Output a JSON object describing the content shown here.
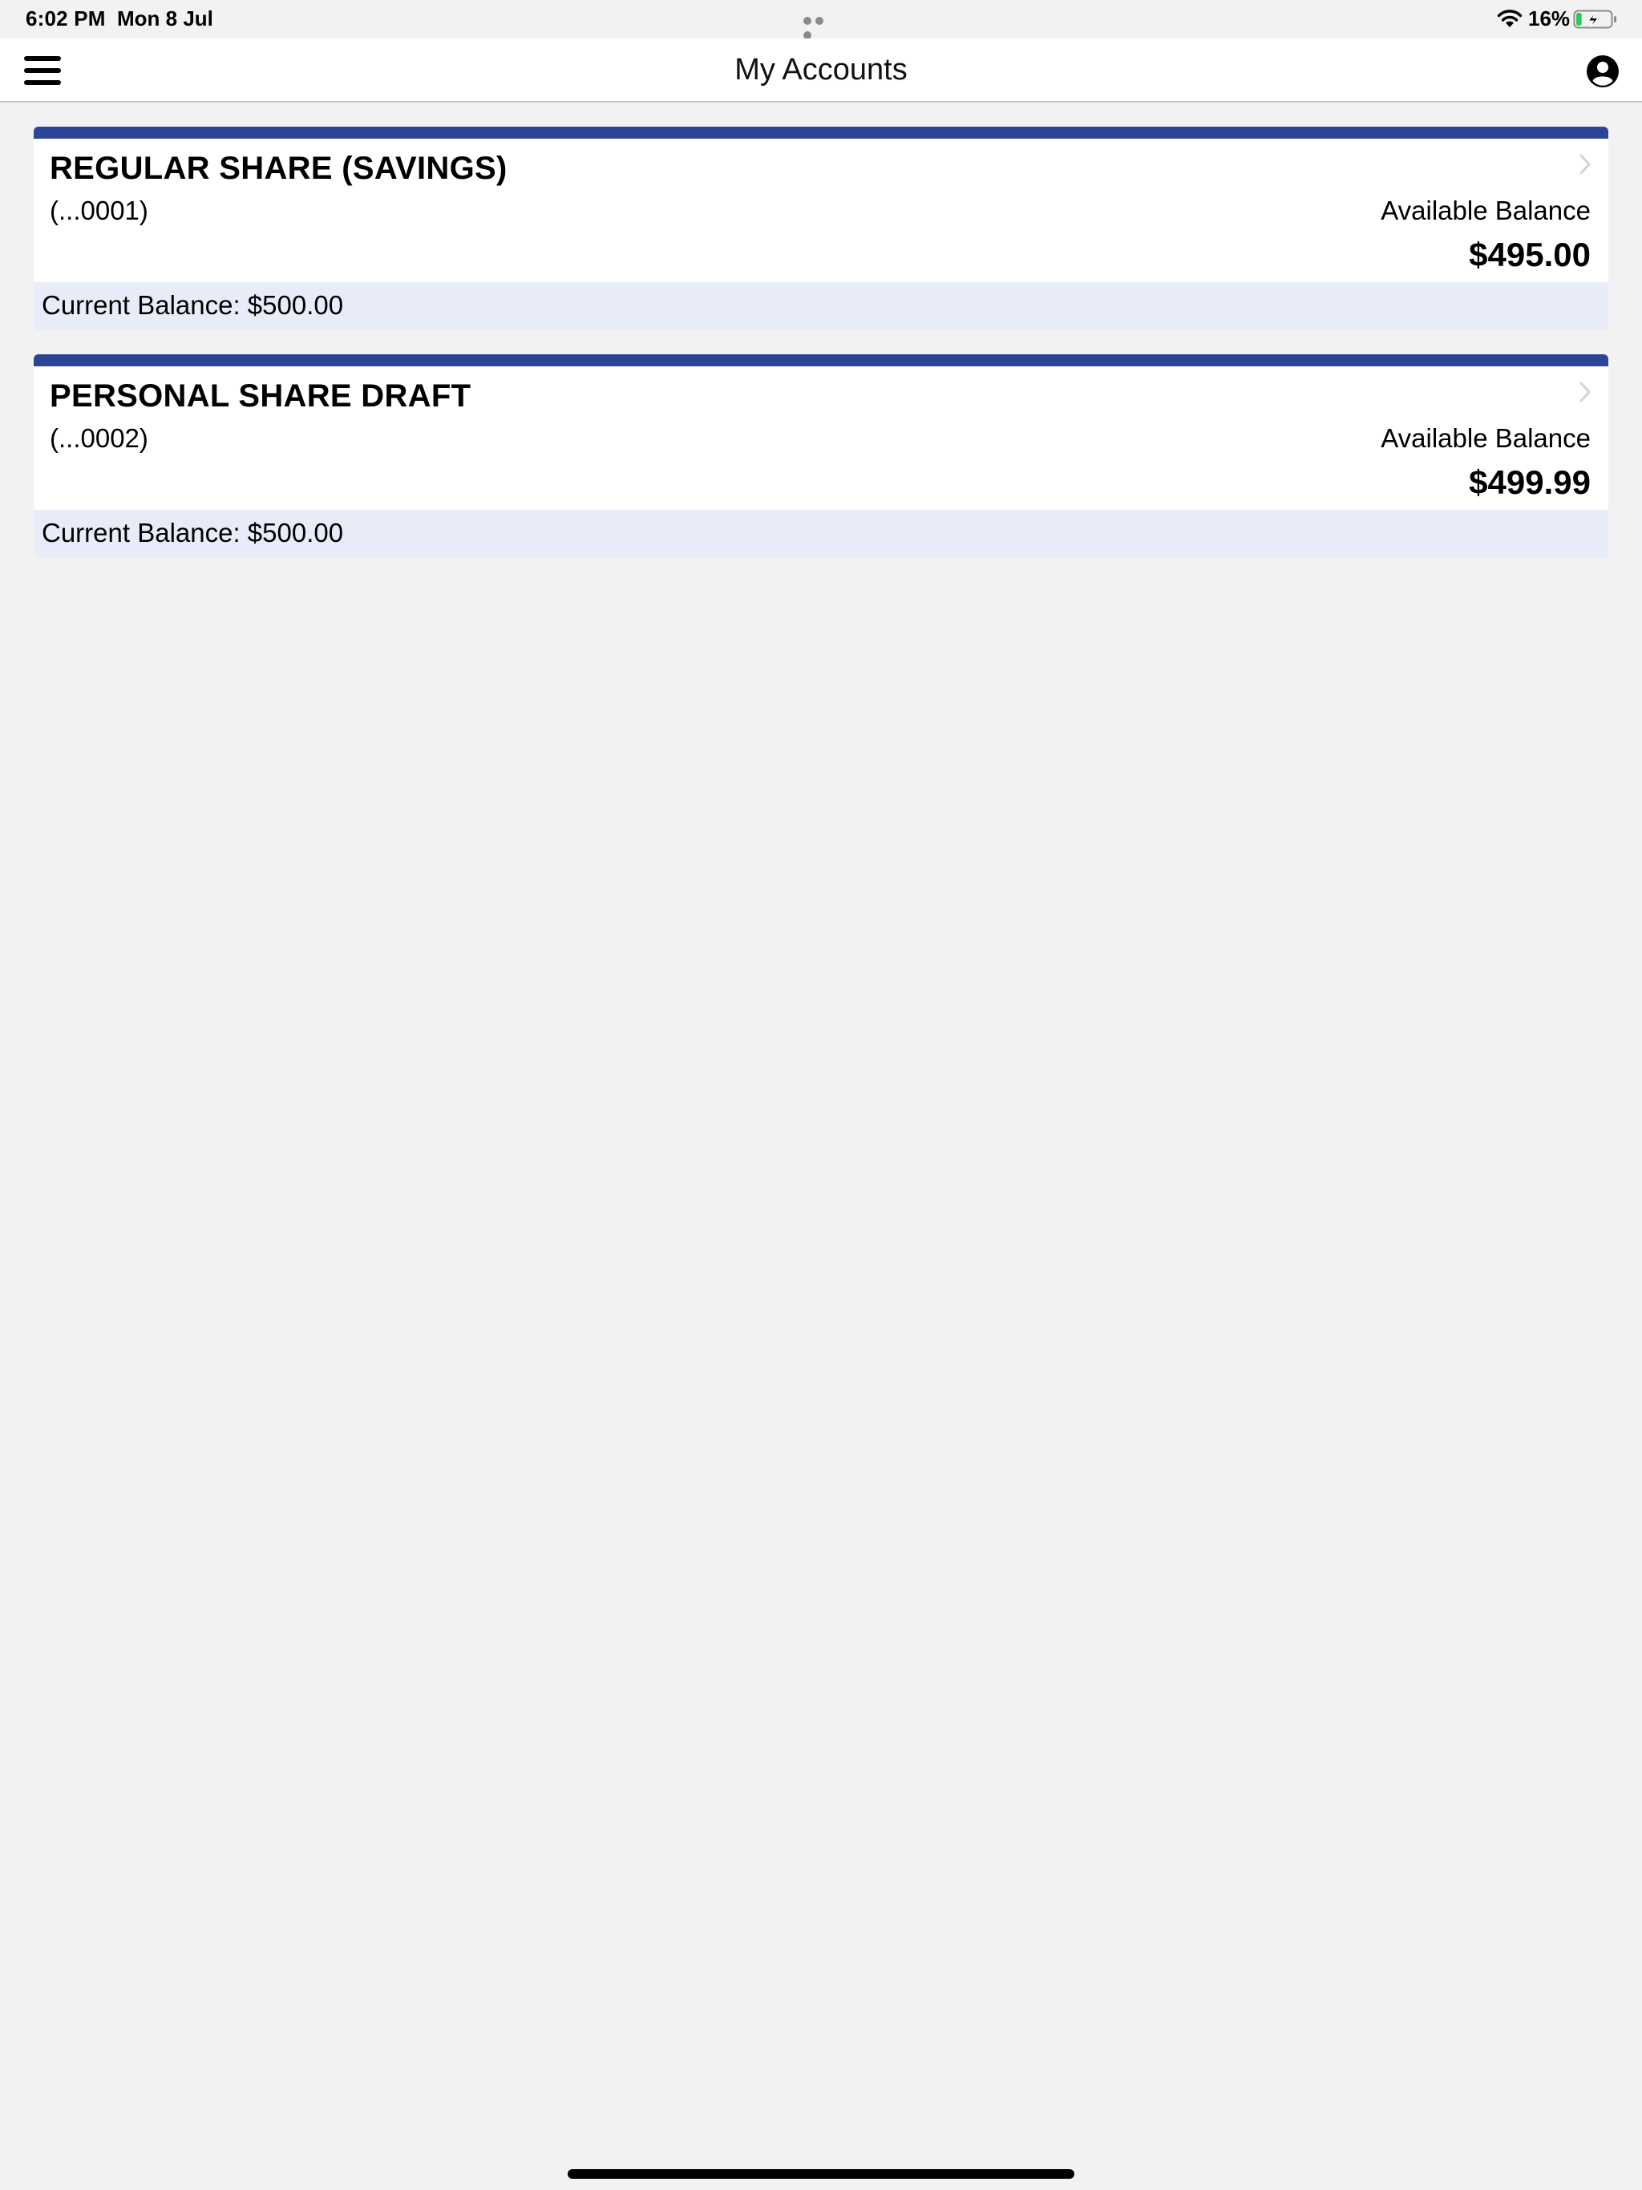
{
  "status_bar": {
    "time": "6:02 PM",
    "date": "Mon 8 Jul",
    "battery_percent": "16%",
    "battery_level": 0.16,
    "wifi_icon": "wifi-icon",
    "battery_icon": "battery-charging-icon"
  },
  "nav": {
    "title": "My Accounts",
    "menu_icon": "hamburger-menu-icon",
    "profile_icon": "user-circle-icon"
  },
  "accounts": [
    {
      "name": "REGULAR SHARE (SAVINGS)",
      "number": "(...0001)",
      "available_label": "Available Balance",
      "available_balance": "$495.00",
      "current_balance": "Current Balance: $500.00"
    },
    {
      "name": "PERSONAL SHARE DRAFT",
      "number": "(...0002)",
      "available_label": "Available Balance",
      "available_balance": "$499.99",
      "current_balance": "Current Balance: $500.00"
    }
  ],
  "colors": {
    "accent": "#2b4495",
    "current_balance_bg": "#e8ecf8",
    "page_bg": "#f2f2f2"
  }
}
